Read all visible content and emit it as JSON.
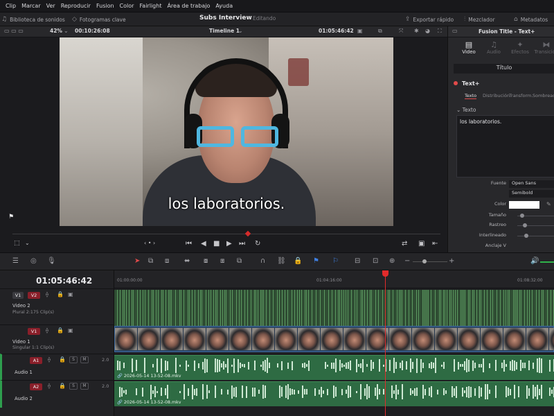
{
  "menubar": {
    "items": [
      "Clip",
      "Marcar",
      "Ver",
      "Reproducir",
      "Fusion",
      "Color",
      "Fairlight",
      "Área de trabajo",
      "Ayuda"
    ]
  },
  "toolbar": {
    "sound_library": "Biblioteca de sonidos",
    "keyframes": "Fotogramas clave",
    "project_title": "Subs Interview",
    "project_status": "Editando",
    "quick_export": "Exportar rápido",
    "mixer": "Mezclador",
    "metadata": "Metadatos"
  },
  "viewer": {
    "zoom": "42%",
    "source_tc": "00:10:26:08",
    "timeline_name": "Timeline 1",
    "record_tc": "01:05:46:42",
    "subtitle": "los laboratorios."
  },
  "inspector": {
    "title": "Fusion Title - Text+",
    "tabs": [
      "Video",
      "Audio",
      "Efectos",
      "Transición"
    ],
    "section": "Título",
    "tool": "Text+",
    "subtabs": [
      "Texto",
      "Distribución",
      "Transform.",
      "Sombreado"
    ],
    "text_group": "Texto",
    "text_value": "los laboratorios.",
    "props": {
      "font_label": "Fuente",
      "font_value": "Open Sans",
      "style_value": "Semibold",
      "color_label": "Color",
      "size_label": "Tamaño",
      "tracking_label": "Rastreo",
      "linespacing_label": "Interlineado",
      "anchor_label": "Anclaje V"
    }
  },
  "timeline": {
    "timecode": "01:05:46:42",
    "ruler": [
      "01:00:00:00",
      "01:04:16:00",
      "01:08:32:00"
    ],
    "tracks": {
      "v2": {
        "src": "V1",
        "dst": "V2",
        "name": "Video 2",
        "info": "Plural 2:175 Clip(s)"
      },
      "v1": {
        "dst": "V1",
        "name": "Video 1",
        "info": "Singular 1:1 Clip(s)"
      },
      "a1": {
        "dst": "A1",
        "name": "Audio 1",
        "vol": "2.0",
        "clip": "2026-05-14 13-52-08.mkv",
        "s": "S",
        "m": "M"
      },
      "a2": {
        "dst": "A2",
        "name": "Audio 2",
        "vol": "2.0",
        "clip": "2026-05-14 13-52-08.mkv",
        "s": "S",
        "m": "M"
      }
    }
  },
  "colors": {
    "accent_red": "#e22b2b",
    "audio_clip": "#2e6b43",
    "video_clip": "#2c4869",
    "subtitle_clip": "#2f4d33",
    "glasses": "#4fb7e0"
  }
}
